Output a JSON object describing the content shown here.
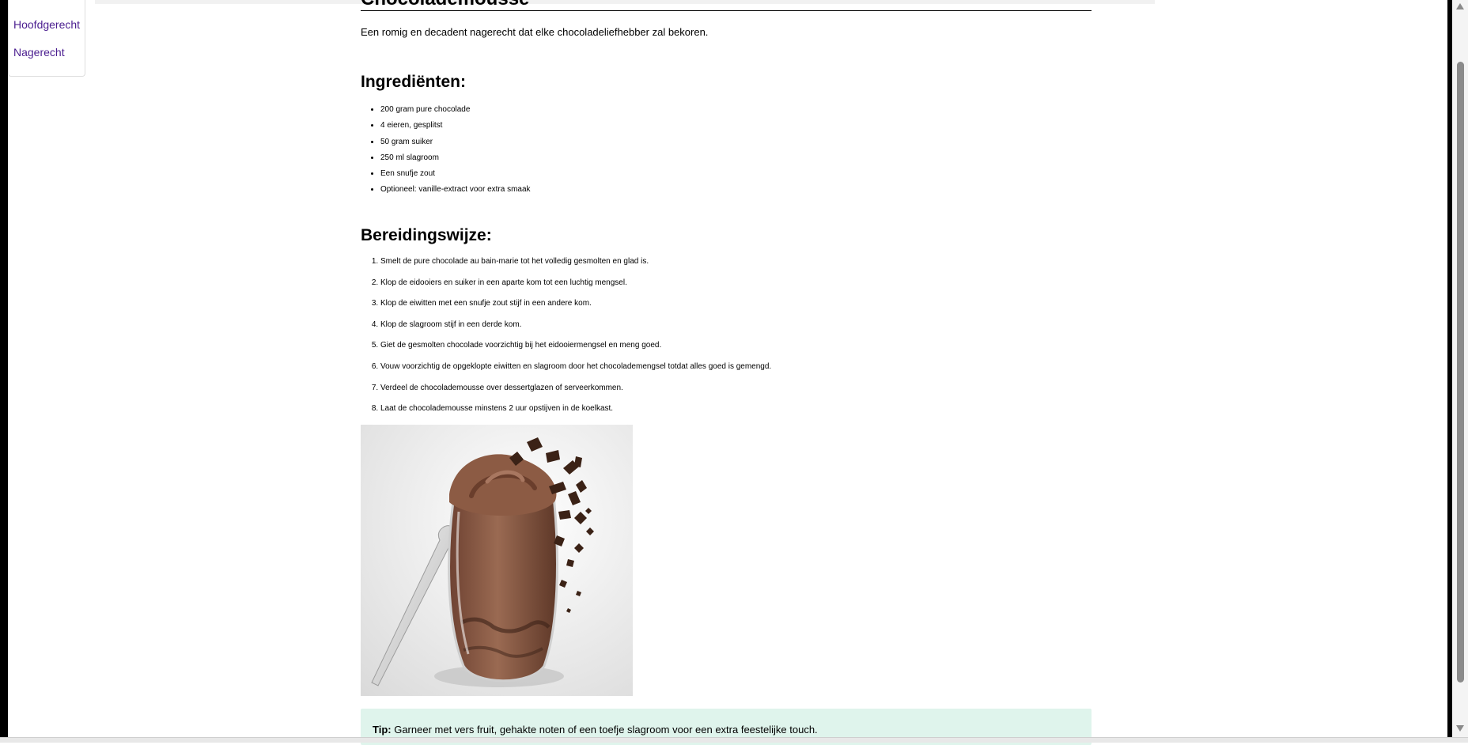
{
  "sidebar": {
    "items": [
      {
        "label": "Hoofdgerecht"
      },
      {
        "label": "Nagerecht"
      }
    ]
  },
  "recipe": {
    "title": "Chocolademousse",
    "intro": "Een romig en decadent nagerecht dat elke chocoladeliefhebber zal bekoren.",
    "ingredients_heading": "Ingrediënten:",
    "ingredients": [
      "200 gram pure chocolade",
      "4 eieren, gesplitst",
      "50 gram suiker",
      "250 ml slagroom",
      "Een snufje zout",
      "Optioneel: vanille-extract voor extra smaak"
    ],
    "steps_heading": "Bereidingswijze:",
    "steps": [
      "Smelt de pure chocolade au bain-marie tot het volledig gesmolten en glad is.",
      "Klop de eidooiers en suiker in een aparte kom tot een luchtig mengsel.",
      "Klop de eiwitten met een snufje zout stijf in een andere kom.",
      "Klop de slagroom stijf in een derde kom.",
      "Giet de gesmolten chocolade voorzichtig bij het eidooiermengsel en meng goed.",
      "Vouw voorzichtig de opgeklopte eiwitten en slagroom door het chocolademengsel totdat alles goed is gemengd.",
      "Verdeel de chocolademousse over dessertglazen of serveerkommen.",
      "Laat de chocolademousse minstens 2 uur opstijven in de koelkast."
    ],
    "tip_label": "Tip:",
    "tip_text": " Garneer met vers fruit, gehakte noten of een toefje slagroom voor een extra feestelijke touch."
  },
  "colors": {
    "link": "#4a1d8f",
    "tip_background": "#dff4ec",
    "mousse": "#8a5a44"
  }
}
